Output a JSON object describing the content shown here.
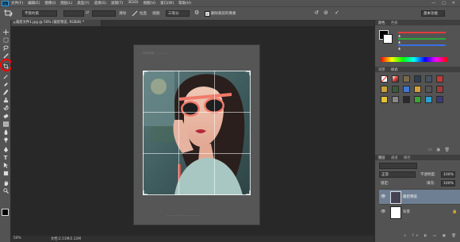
{
  "menubar": {
    "logo": "Ps",
    "items": [
      "文件(F)",
      "编辑(E)",
      "图像(I)",
      "图层(L)",
      "类型(Y)",
      "选择(S)",
      "滤镜(T)",
      "3D(D)",
      "视图(V)",
      "窗口(W)",
      "帮助(H)"
    ],
    "window_controls": [
      "—",
      "□",
      "✕"
    ]
  },
  "options": {
    "ratio_select": "不受约束",
    "clear_label": "清除",
    "straighten_label": "拉直",
    "view_label": "视图:",
    "view_select": "三等分",
    "delete_pixels_label": "删除裁剪的像素",
    "workspace_select": "基本功能"
  },
  "document": {
    "tab_title": "裁剪文件1.jpg @ 50% (裁剪预览, RGB/8) *",
    "zoom": "50%",
    "doc_size": "文档:2.51M/2.22M"
  },
  "artboard": {
    "header_text": "时尚写真 ·————·",
    "footer_text": "——————·——————"
  },
  "colors": {
    "accent": "#2fa3e6",
    "highlight_circle": "#ff0000",
    "panel_bg": "#535353",
    "canvas_bg": "#282828"
  },
  "panels": {
    "color_tabs": [
      "颜色",
      "色板"
    ],
    "color_sliders": [
      {
        "name": "R",
        "color": "#e23a3a"
      },
      {
        "name": "G",
        "color": "#2fa83a"
      },
      {
        "name": "B",
        "color": "#3a6ee2"
      }
    ],
    "adjust_tabs": [
      "调整",
      "样式"
    ],
    "layers_tabs": [
      "图层",
      "通道",
      "路径"
    ],
    "blend_mode": "正常",
    "opacity_label": "不透明度:",
    "opacity_value": "100%",
    "lock_label": "锁定:",
    "fill_label": "填充:",
    "fill_value": "100%",
    "layers": [
      {
        "name": "裁剪预览",
        "selected": true
      },
      {
        "name": "背景",
        "selected": false
      }
    ]
  },
  "tools": [
    "move-tool",
    "marquee-tool",
    "lasso-tool",
    "quick-select-tool",
    "crop-tool",
    "eyedropper-tool",
    "healing-tool",
    "brush-tool",
    "stamp-tool",
    "history-brush-tool",
    "eraser-tool",
    "gradient-tool",
    "blur-tool",
    "dodge-tool",
    "pen-tool",
    "type-tool",
    "path-select-tool",
    "shape-tool",
    "hand-tool",
    "zoom-tool"
  ]
}
